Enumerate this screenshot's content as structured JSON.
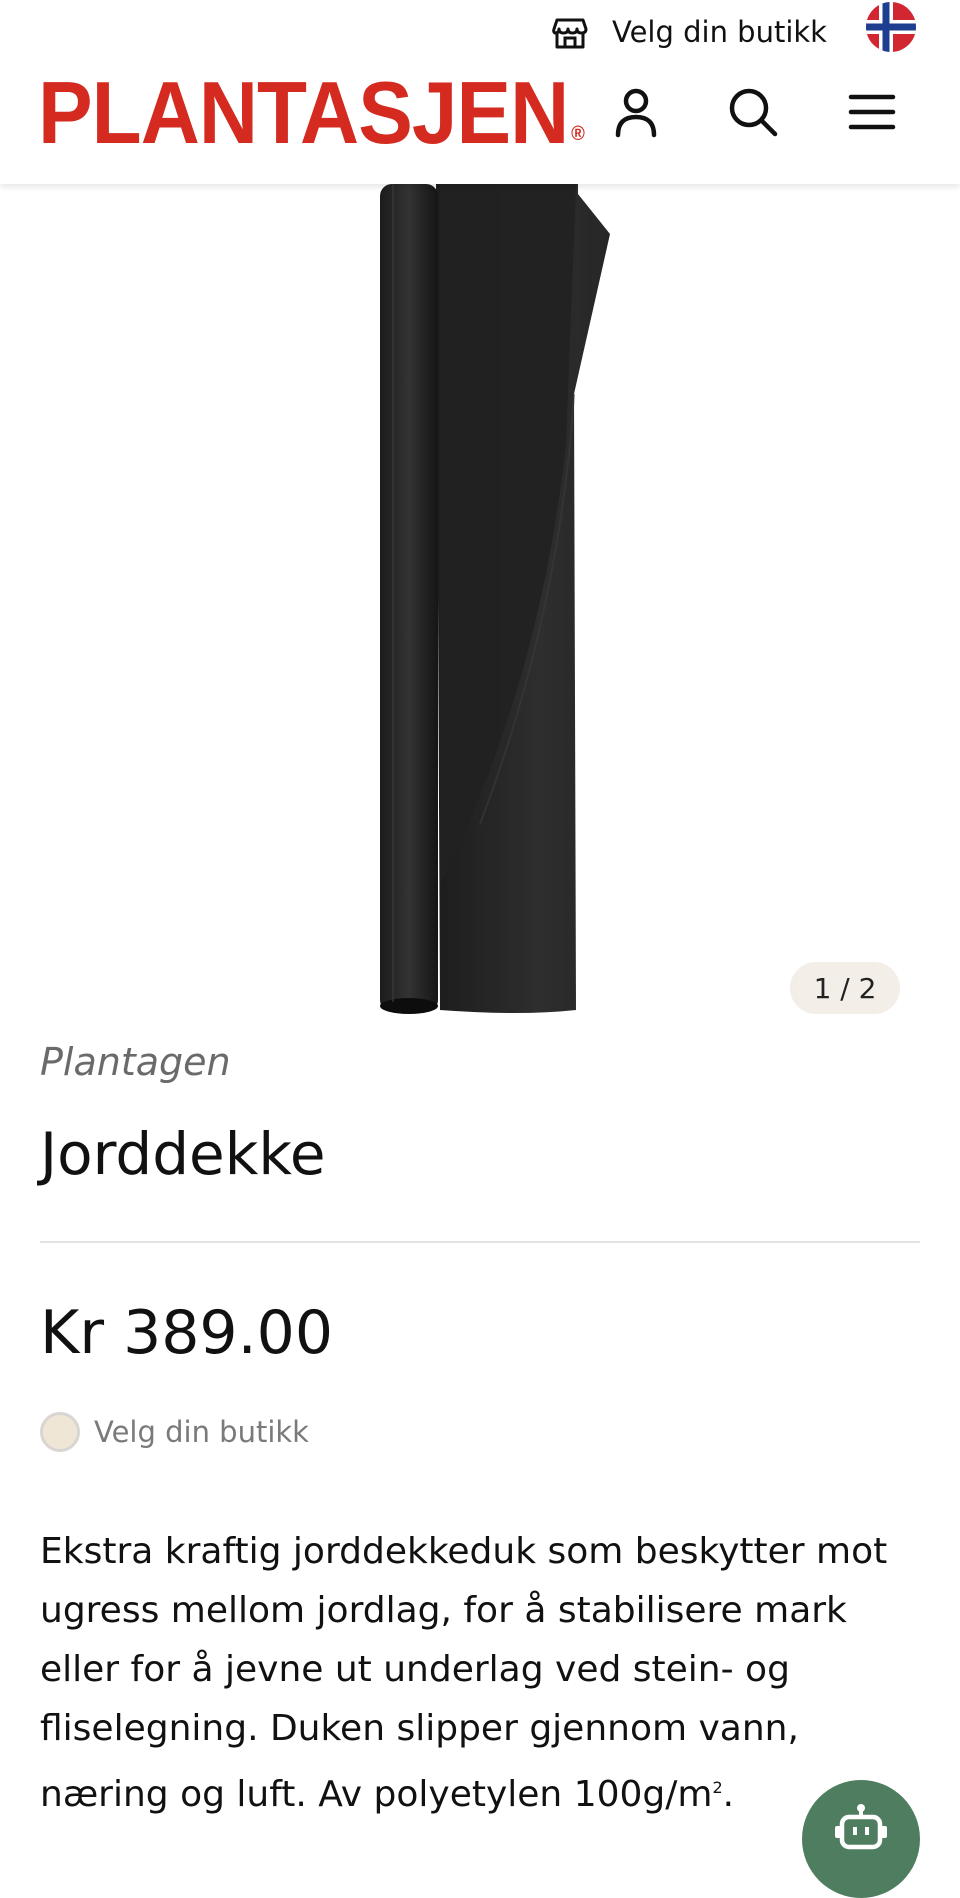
{
  "header": {
    "store_label": "Velg din butikk",
    "logo_text": "PLANTASJEN",
    "logo_mark": "®",
    "brand_color": "#d42a20",
    "icons": [
      "store-icon",
      "norway-flag-icon",
      "user-icon",
      "search-icon",
      "menu-icon"
    ]
  },
  "gallery": {
    "counter": "1 / 2"
  },
  "product": {
    "brand": "Plantagen",
    "title": "Jorddekke",
    "price": "Kr 389.00",
    "stock_label": "Velg din butikk",
    "description": "Ekstra kraftig jorddekkeduk som beskytter mot ugress mellom jordlag, for å stabilisere mark eller for å jevne ut underlag ved stein- og fliselegning. Duken slipper gjennom vann, næring og luft. Av polyetylen 100g/m",
    "description_unit_exp": "2",
    "description_end": "."
  },
  "chat": {
    "icon": "chatbot-icon",
    "color": "#4e7d5f"
  }
}
